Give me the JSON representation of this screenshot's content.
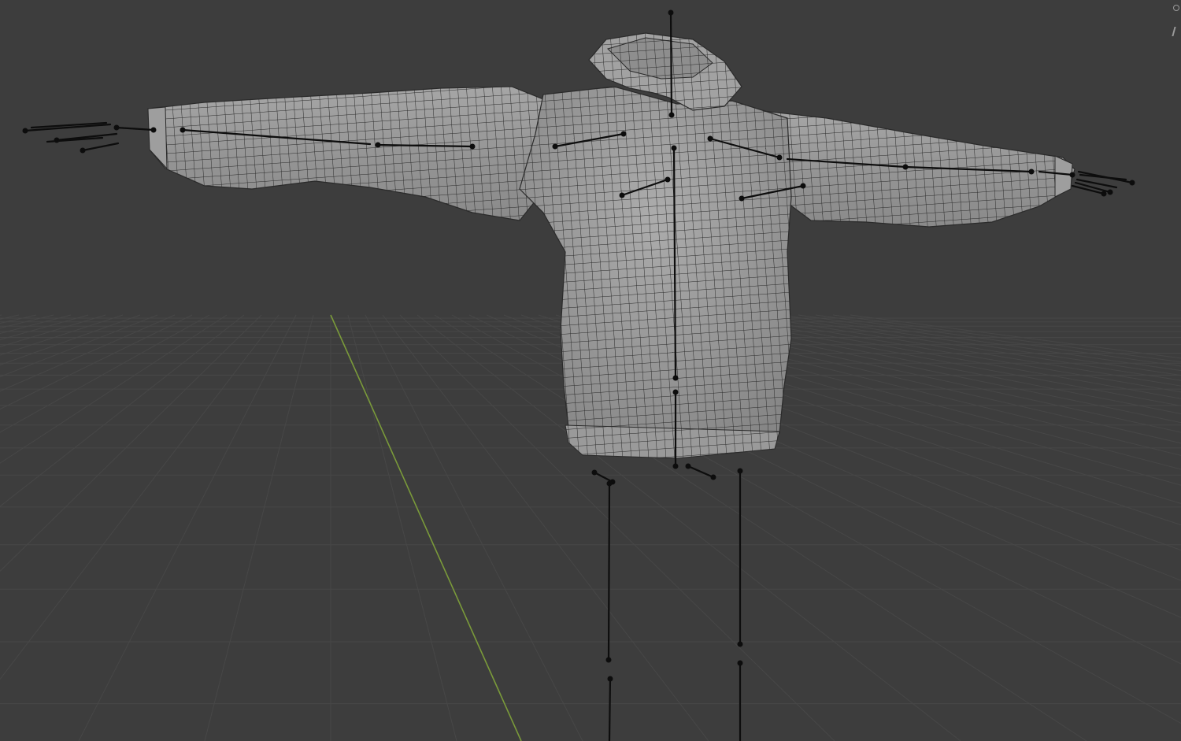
{
  "viewport": {
    "background": "#3d3d3d",
    "grid_color": "#474747",
    "y_axis_color": "#7a9a3a"
  },
  "object": {
    "name": "hoodie-mesh",
    "display": "wireframe-on-shaded",
    "mesh_color": "#9a9a9a",
    "wire_color": "#2a2a2a"
  },
  "armature": {
    "name": "armature-rig",
    "display": "stick",
    "bone_color": "#0d0d0d"
  },
  "navigation_gizmo": {
    "icons": [
      "navigation-gizmo-icon",
      "axis-gizmo-icon"
    ]
  }
}
